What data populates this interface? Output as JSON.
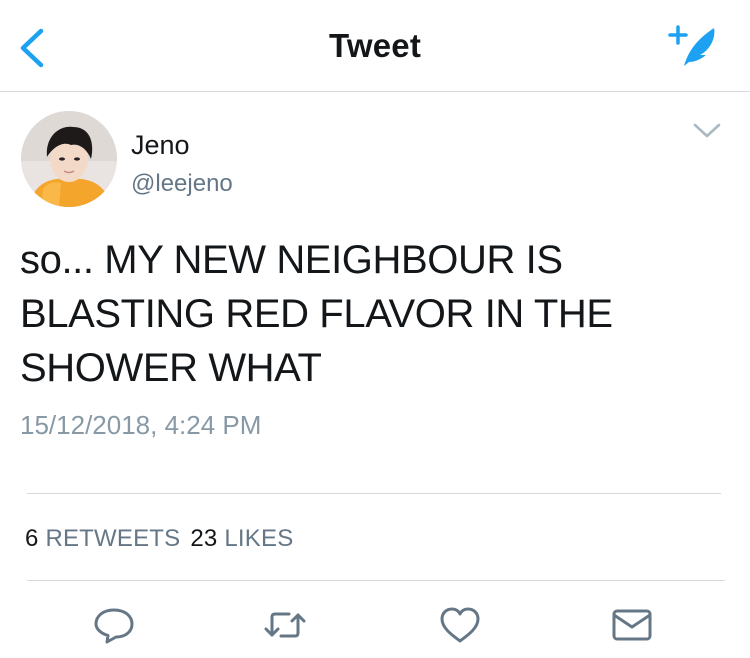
{
  "header": {
    "title": "Tweet",
    "back_icon": "chevron-left-icon",
    "compose_icon": "compose-feather-icon"
  },
  "tweet": {
    "display_name": "Jeno",
    "handle": "@leejeno",
    "text": "so... MY NEW NEIGHBOUR IS\nBLASTING RED FLAVOR IN THE\nSHOWER WHAT",
    "timestamp": "15/12/2018, 4:24 PM",
    "retweets_count": "6",
    "retweets_label": "RETWEETS",
    "likes_count": "23",
    "likes_label": "LIKES"
  },
  "actions": [
    "reply-icon",
    "retweet-icon",
    "like-icon",
    "direct-message-icon"
  ],
  "colors": {
    "accent": "#1da1f2",
    "secondary_text": "#657786",
    "timestamp": "#8899a6",
    "icon_gray": "#657786",
    "divider": "#d6dadf"
  }
}
